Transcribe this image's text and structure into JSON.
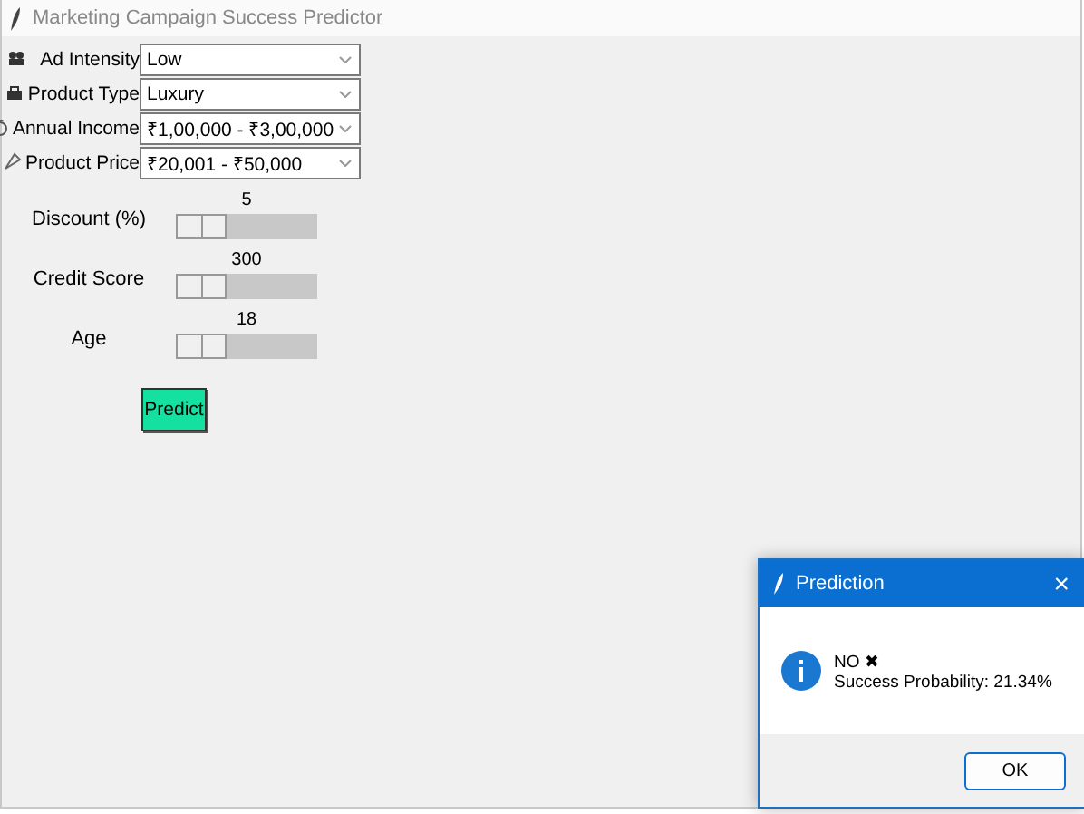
{
  "window": {
    "title": "Marketing Campaign Success Predictor"
  },
  "fields": [
    {
      "label": "Ad Intensity",
      "value": "Low"
    },
    {
      "label": "Product Type",
      "value": "Luxury"
    },
    {
      "label": "Annual Income",
      "value": "₹1,00,000 - ₹3,00,000"
    },
    {
      "label": "Product Price",
      "value": "₹20,001 - ₹50,000"
    }
  ],
  "sliders": [
    {
      "label": "Discount (%)",
      "reading": "5",
      "level": 0
    },
    {
      "label": "Credit Score",
      "reading": "300",
      "level": 0
    },
    {
      "label": "Age",
      "reading": "18",
      "level": 0
    }
  ],
  "predict_button": "Predict",
  "dialog": {
    "title": "Prediction",
    "close": "×",
    "result": "NO",
    "result_mark": "✖",
    "message": "Success Probability: 21.34%",
    "ok_button": "OK"
  }
}
